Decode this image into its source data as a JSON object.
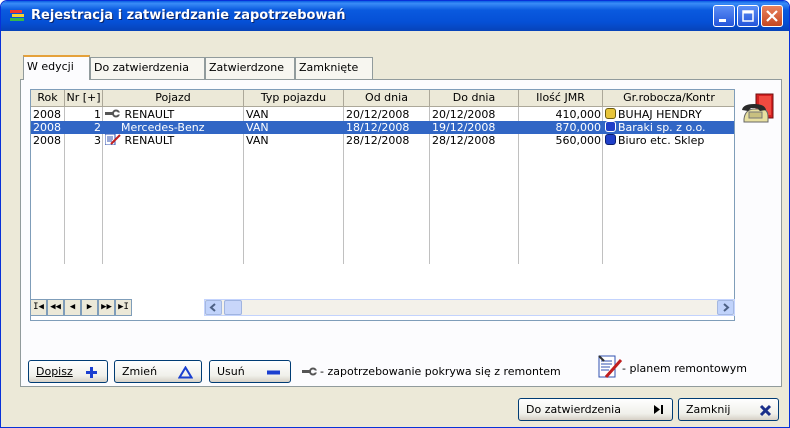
{
  "window": {
    "title": "Rejestracja i zatwierdzanie zapotrzebowań",
    "title_buttons": [
      "minimize",
      "maximize",
      "close"
    ]
  },
  "tabs": [
    {
      "label": "W edycji",
      "active": true
    },
    {
      "label": "Do zatwierdzenia",
      "active": false
    },
    {
      "label": "Zatwierdzone",
      "active": false
    },
    {
      "label": "Zamknięte",
      "active": false
    }
  ],
  "table": {
    "columns": [
      "Rok",
      "Nr [+]",
      "Pojazd",
      "Typ pojazdu",
      "Od dnia",
      "Do dnia",
      "Ilość JMR",
      "Gr.robocza/Kontr"
    ],
    "rows": [
      {
        "rok": "2008",
        "nr": "1",
        "pojazd": "RENAULT",
        "pojazd_icon": "repair-link-icon",
        "typ": "VAN",
        "od": "20/12/2008",
        "do": "20/12/2008",
        "ilosc": "410,000",
        "gr": "BUHAJ HENDRY",
        "gr_icon": "person-icon",
        "selected": false
      },
      {
        "rok": "2008",
        "nr": "2",
        "pojazd": "Mercedes-Benz",
        "pojazd_icon": "",
        "typ": "VAN",
        "od": "18/12/2008",
        "do": "19/12/2008",
        "ilosc": "870,000",
        "gr": "Baraki sp. z o.o.",
        "gr_icon": "company-icon",
        "selected": true
      },
      {
        "rok": "2008",
        "nr": "3",
        "pojazd": "RENAULT",
        "pojazd_icon": "repair-plan-icon",
        "typ": "VAN",
        "od": "28/12/2008",
        "do": "28/12/2008",
        "ilosc": "560,000",
        "gr": "Biuro etc. Sklep",
        "gr_icon": "company-icon",
        "selected": false
      }
    ]
  },
  "navigator": {
    "buttons": [
      "first",
      "prev-page",
      "prev",
      "next",
      "next-page",
      "last"
    ],
    "glyphs": [
      "I◀",
      "◀◀",
      "◀",
      "▶",
      "▶▶",
      "▶I"
    ]
  },
  "actions": {
    "add_label": "Dopisz",
    "edit_label": "Zmień",
    "delete_label": "Usuń"
  },
  "legend": {
    "repair_text": "- zapotrzebowanie pokrywa się z remontem",
    "plan_text": "- planem remontowym"
  },
  "footer": {
    "approve_label": "Do zatwierdzenia",
    "close_label": "Zamknij"
  },
  "colors": {
    "titlebar": "#0550D6",
    "selection": "#3166C5",
    "add_icon": "#1A3FD0",
    "close_x": "#1A2F8A"
  }
}
